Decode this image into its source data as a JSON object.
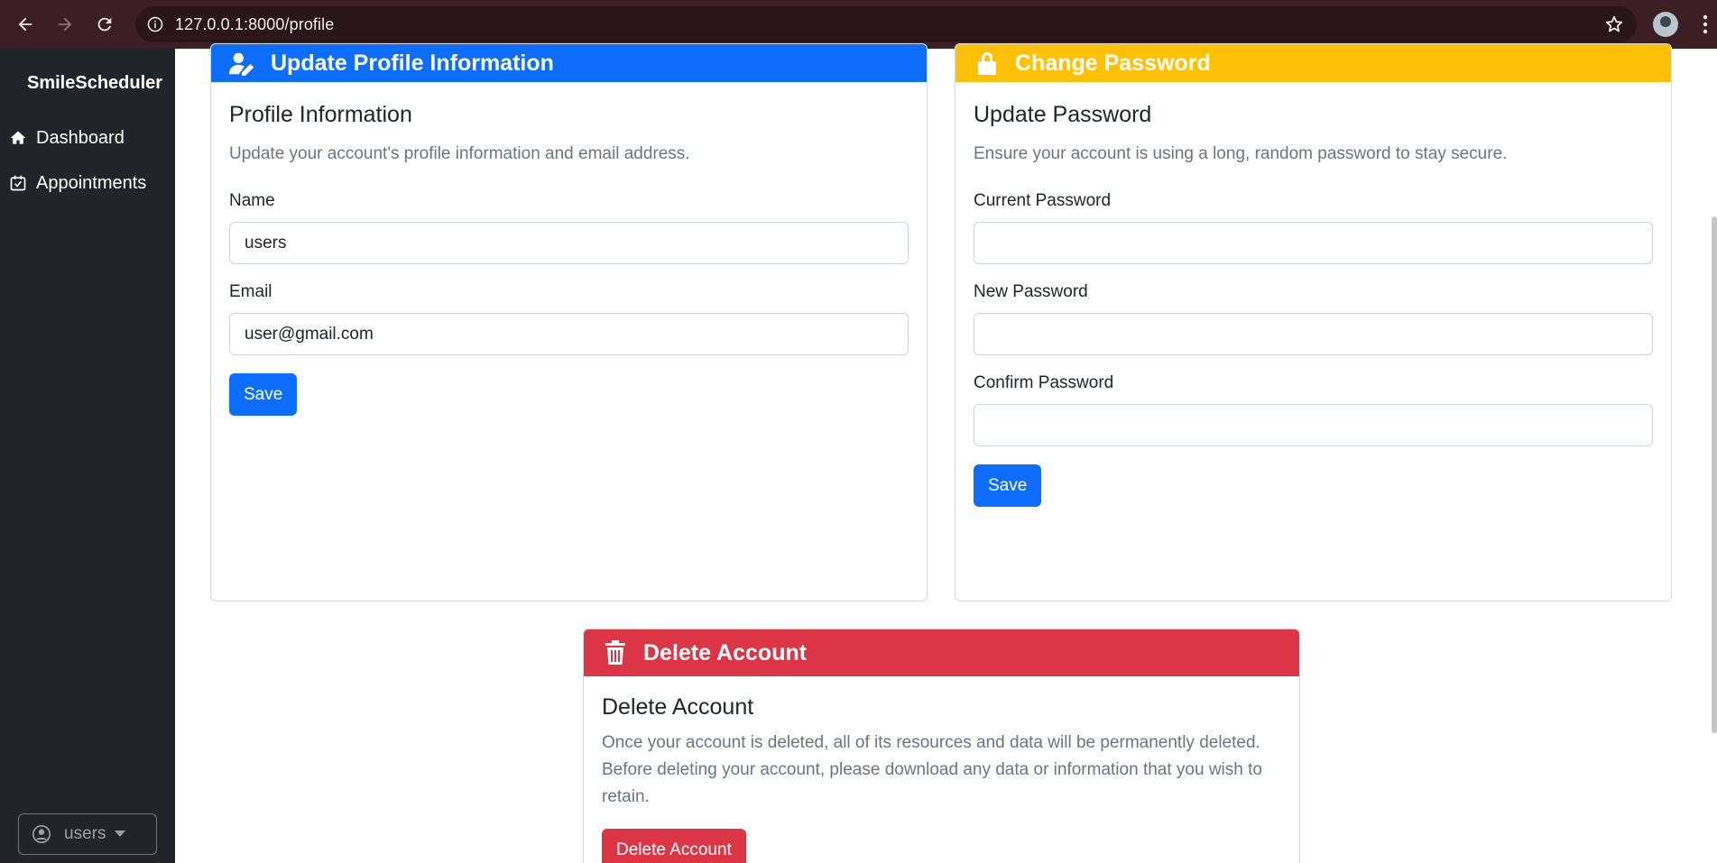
{
  "browser": {
    "url": "127.0.0.1:8000/profile"
  },
  "sidebar": {
    "brand": "SmileScheduler",
    "items": [
      {
        "label": "Dashboard",
        "icon": "house-icon"
      },
      {
        "label": "Appointments",
        "icon": "calendar-check-icon"
      }
    ],
    "user_menu": {
      "label": "users",
      "icon": "user-circle-icon"
    }
  },
  "profile_card": {
    "header": "Update Profile Information",
    "title": "Profile Information",
    "description": "Update your account's profile information and email address.",
    "name_label": "Name",
    "name_value": "users",
    "email_label": "Email",
    "email_value": "user@gmail.com",
    "save_label": "Save",
    "color": "#0d6efd"
  },
  "password_card": {
    "header": "Change Password",
    "title": "Update Password",
    "description": "Ensure your account is using a long, random password to stay secure.",
    "current_label": "Current Password",
    "current_value": "",
    "new_label": "New Password",
    "new_value": "",
    "confirm_label": "Confirm Password",
    "confirm_value": "",
    "save_label": "Save",
    "color": "#ffc107"
  },
  "delete_card": {
    "header": "Delete Account",
    "title": "Delete Account",
    "description": "Once your account is deleted, all of its resources and data will be permanently deleted. Before deleting your account, please download any data or information that you wish to retain.",
    "button_label": "Delete Account",
    "color": "#dc3545"
  }
}
